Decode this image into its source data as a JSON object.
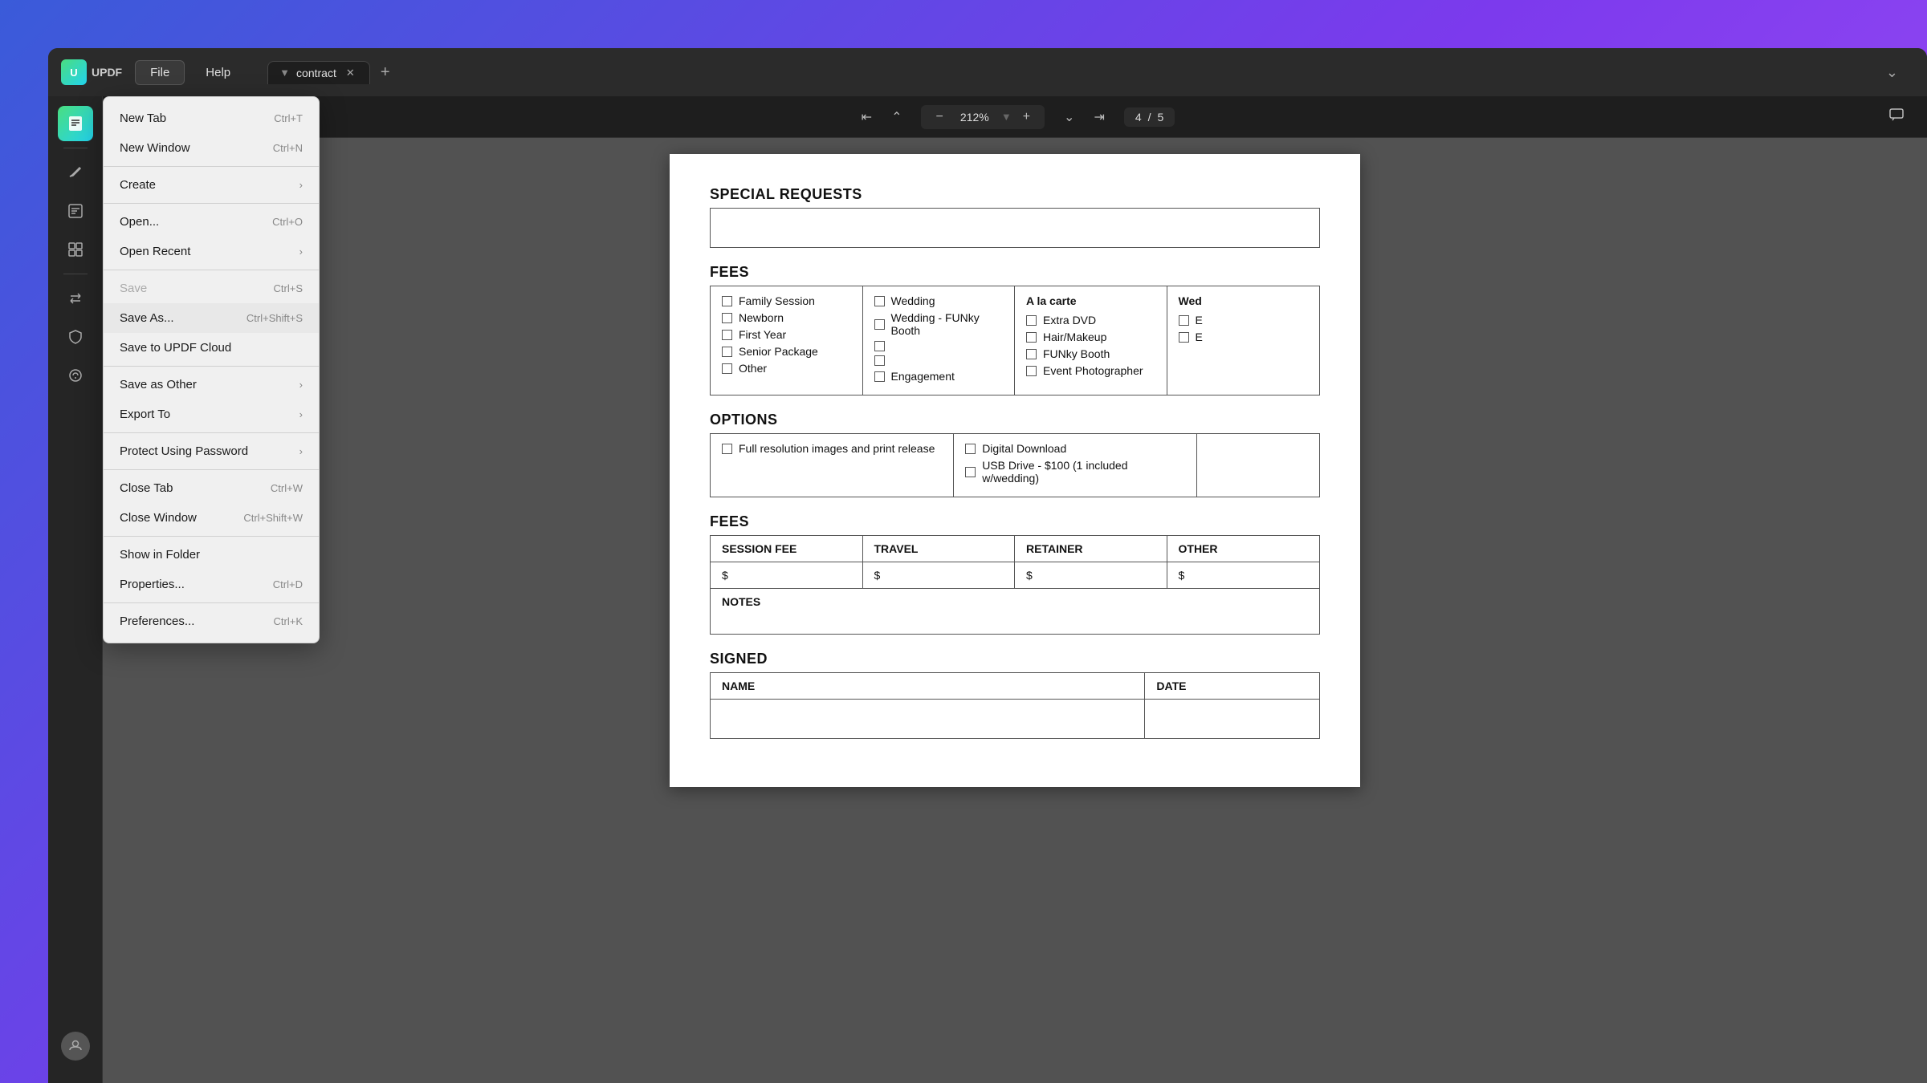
{
  "app": {
    "logo": "UPDF",
    "title_bar": {
      "file_label": "File",
      "help_label": "Help",
      "tab_name": "contract",
      "add_tab_label": "+"
    }
  },
  "toolbar": {
    "zoom": "212%",
    "page_current": "4",
    "page_total": "5"
  },
  "sidebar": {
    "icons": [
      {
        "name": "read-icon",
        "symbol": "📄",
        "active": true
      },
      {
        "name": "annotate-icon",
        "symbol": "✏️",
        "active": false
      },
      {
        "name": "edit-icon",
        "symbol": "🔤",
        "active": false
      },
      {
        "name": "organize-icon",
        "symbol": "📋",
        "active": false
      },
      {
        "name": "convert-icon",
        "symbol": "🔄",
        "active": false
      },
      {
        "name": "protect-icon",
        "symbol": "🛡️",
        "active": false
      },
      {
        "name": "ai-icon",
        "symbol": "✨",
        "active": false
      }
    ]
  },
  "menu": {
    "items": [
      {
        "label": "New Tab",
        "shortcut": "Ctrl+T",
        "has_arrow": false,
        "disabled": false
      },
      {
        "label": "New Window",
        "shortcut": "Ctrl+N",
        "has_arrow": false,
        "disabled": false
      },
      {
        "label": "Create",
        "shortcut": "",
        "has_arrow": true,
        "disabled": false
      },
      {
        "label": "Open...",
        "shortcut": "Ctrl+O",
        "has_arrow": false,
        "disabled": false
      },
      {
        "label": "Open Recent",
        "shortcut": "",
        "has_arrow": true,
        "disabled": false
      },
      {
        "label": "Save",
        "shortcut": "Ctrl+S",
        "has_arrow": false,
        "disabled": true
      },
      {
        "label": "Save As...",
        "shortcut": "Ctrl+Shift+S",
        "has_arrow": false,
        "disabled": false
      },
      {
        "label": "Save to UPDF Cloud",
        "shortcut": "",
        "has_arrow": false,
        "disabled": false
      },
      {
        "label": "Save as Other",
        "shortcut": "",
        "has_arrow": true,
        "disabled": false
      },
      {
        "label": "Export To",
        "shortcut": "",
        "has_arrow": true,
        "disabled": false
      },
      {
        "label": "Protect Using Password",
        "shortcut": "",
        "has_arrow": true,
        "disabled": false
      },
      {
        "label": "Close Tab",
        "shortcut": "Ctrl+W",
        "has_arrow": false,
        "disabled": false
      },
      {
        "label": "Close Window",
        "shortcut": "Ctrl+Shift+W",
        "has_arrow": false,
        "disabled": false
      },
      {
        "label": "Show in Folder",
        "shortcut": "",
        "has_arrow": false,
        "disabled": false
      },
      {
        "label": "Properties...",
        "shortcut": "Ctrl+D",
        "has_arrow": false,
        "disabled": false
      },
      {
        "label": "Preferences...",
        "shortcut": "Ctrl+K",
        "has_arrow": false,
        "disabled": false
      }
    ]
  },
  "document": {
    "special_requests": {
      "title": "SPECIAL REQUESTS"
    },
    "fees_top": {
      "title": "FEES",
      "columns": [
        {
          "header": "",
          "items": [
            "Family Session",
            "Newborn",
            "First Year",
            "Senior Package",
            "Other"
          ]
        },
        {
          "header": "",
          "items": [
            "Wedding",
            "Wedding - FUNky Booth",
            "",
            "",
            "Engagement"
          ]
        },
        {
          "header": "A la carte",
          "items": [
            "Extra DVD",
            "Hair/Makeup",
            "FUNky Booth",
            "Event Photographer"
          ]
        },
        {
          "header": "Wed",
          "items": [
            "",
            ""
          ]
        }
      ]
    },
    "options": {
      "title": "OPTIONS",
      "col1": {
        "item": "Full resolution images and print release"
      },
      "col2": {
        "items": [
          "Digital Download",
          "USB Drive - $100 (1 included w/wedding)"
        ]
      }
    },
    "fees_bottom": {
      "title": "FEES",
      "headers": [
        "SESSION FEE",
        "TRAVEL",
        "RETAINER",
        "OTHER"
      ],
      "values": [
        "$",
        "$",
        "$",
        "$"
      ],
      "notes_label": "NOTES"
    },
    "signed": {
      "title": "SIGNED",
      "name_label": "NAME",
      "date_label": "DATE"
    },
    "funky_booth_text": "Wedding FUNky Booth",
    "funky_booth_text2": "FUNky Booth"
  }
}
